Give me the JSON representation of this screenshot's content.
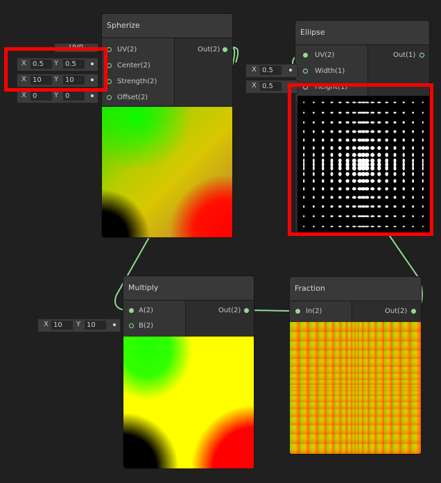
{
  "nodes": {
    "spherize": {
      "title": "Spherize",
      "inputs": [
        "UV(2)",
        "Center(2)",
        "Strength(2)",
        "Offset(2)"
      ],
      "output": "Out(2)"
    },
    "ellipse": {
      "title": "Ellipse",
      "inputs": [
        "UV(2)",
        "Width(1)",
        "Height(1)"
      ],
      "output": "Out(1)"
    },
    "multiply": {
      "title": "Multiply",
      "inputs": [
        "A(2)",
        "B(2)"
      ],
      "output": "Out(2)"
    },
    "fraction": {
      "title": "Fraction",
      "inputs": [
        "In(2)"
      ],
      "output": "Out(2)"
    }
  },
  "fields": {
    "uv_chip": "UV0",
    "center": {
      "x_label": "X",
      "x": "0.5",
      "y_label": "Y",
      "y": "0.5"
    },
    "strength": {
      "x_label": "X",
      "x": "10",
      "y_label": "Y",
      "y": "10"
    },
    "offset": {
      "x_label": "X",
      "x": "0",
      "y_label": "Y",
      "y": "0"
    },
    "ellipse_width": {
      "x_label": "X",
      "x": "0.5"
    },
    "ellipse_height": {
      "x_label": "X",
      "x": "0.5"
    },
    "multiply_b": {
      "x_label": "X",
      "x": "10",
      "y_label": "Y",
      "y": "10"
    }
  },
  "colors": {
    "wire": "#8fdc8f",
    "highlight": "#ff0000",
    "background": "#202020"
  }
}
